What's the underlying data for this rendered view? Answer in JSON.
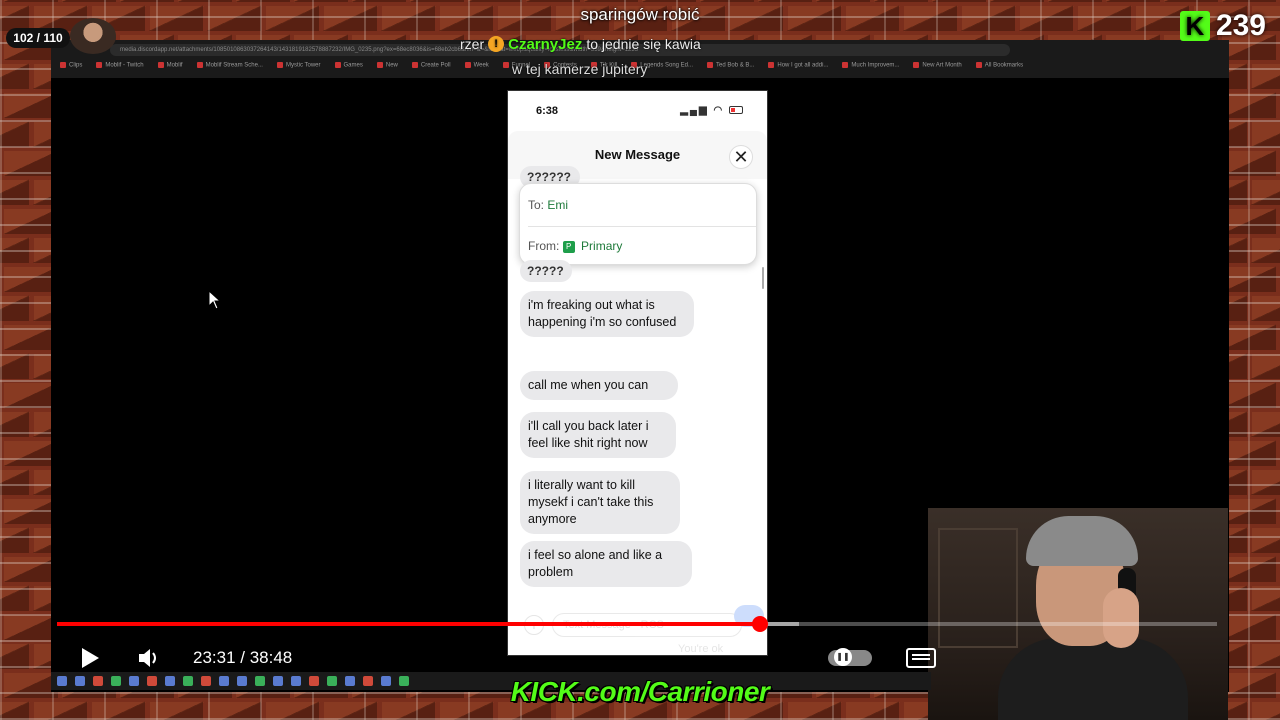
{
  "overlay": {
    "top_text": "sparingów robić",
    "viewer_count": "102 / 110",
    "kick_follower_count": "239",
    "kick_logo_letter": "K",
    "chat_user": "CzarnyJez",
    "chat_prefix": "rzer",
    "chat_message": "to jednie się kawia",
    "chat_line2": "w tej kamerze jupitery",
    "bottom_url": "KICK.com/Carrioner"
  },
  "browser": {
    "url": "media.discordapp.net/attachments/1085010863037264143/1431819182578887232/IMG_0235.png?ex=68ec8036&is=68eb2cb6&hm=&=&format=webp&quality=lossless&width=559&height=1235",
    "bookmarks": [
      "Clips",
      "Moblif - Twitch",
      "Moblif",
      "Moblif Stream Sche...",
      "Mystic Tower",
      "Games",
      "New",
      "Create Poll",
      "Week",
      "Funnel",
      "Contests",
      "Tik Kill",
      "Legends Song Ed...",
      "Ted Bob & B...",
      "How I got all addi...",
      "Much Improvem...",
      "New Art Month",
      "All Bookmarks"
    ]
  },
  "phone": {
    "status_time": "6:38",
    "status_icons": "▂▄▆ ◠",
    "sheet_title": "New Message",
    "close_icon": "✕",
    "top_bubble": "??????",
    "to_label": "To:",
    "to_value": "Emi",
    "from_label": "From:",
    "from_value": "Primary",
    "from_icon_letter": "P",
    "bubble_q": "?????",
    "messages": [
      "i'm freaking out what is happening i'm so confused",
      "call me when you can",
      "i'll call you back later i feel like shit right now",
      "i literally want to kill mysekf i can't take this anymore",
      "i feel so alone and like a problem"
    ],
    "composer_placeholder": "Text Message · RCS",
    "toast": "You're ok"
  },
  "player": {
    "current_time": "23:31",
    "duration": "38:48",
    "time_separator": " / ",
    "progress_fraction": 0.606,
    "buffer_fraction": 0.64
  },
  "colors": {
    "kick_green": "#53fc18",
    "progress_red": "#ff0000",
    "imessage_gray": "#e9e9eb"
  }
}
